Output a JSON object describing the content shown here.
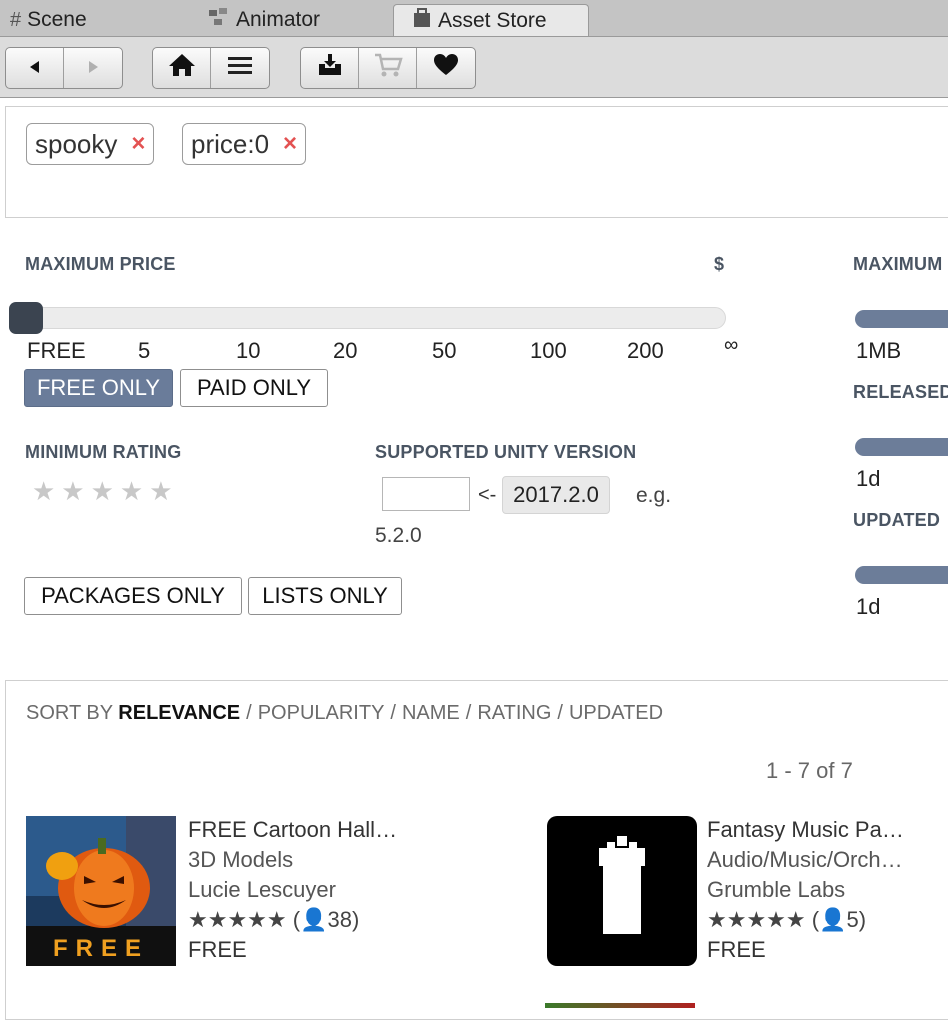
{
  "tabs": [
    {
      "label": "Scene",
      "icon": "grid-icon"
    },
    {
      "label": "Animator",
      "icon": "animator-icon"
    },
    {
      "label": "Asset Store",
      "icon": "store-bag-icon",
      "active": true
    }
  ],
  "toolbar": {
    "buttons": [
      "back-arrow-icon",
      "forward-arrow-icon",
      "home-icon",
      "menu-icon",
      "download-tray-icon",
      "cart-icon",
      "heart-icon"
    ]
  },
  "search": {
    "chips": [
      {
        "label": "spooky",
        "remove": "×"
      },
      {
        "label": "price:0",
        "remove": "×"
      }
    ]
  },
  "filters": {
    "max_price_label": "MAXIMUM PRICE",
    "currency": "$",
    "price_ticks": [
      "FREE",
      "5",
      "10",
      "20",
      "50",
      "100",
      "200",
      "∞"
    ],
    "price_value": "FREE",
    "free_only": "FREE ONLY",
    "paid_only": "PAID ONLY",
    "min_rating_label": "MINIMUM RATING",
    "rating_stars": "★★★★★",
    "rating_value": 0,
    "unity_version_label": "SUPPORTED UNITY VERSION",
    "version_input_value": "",
    "arrow": "<-",
    "current_version": "2017.2.0",
    "example_prefix": "e.g.",
    "example_version": "5.2.0",
    "packages_only": "PACKAGES ONLY",
    "lists_only": "LISTS ONLY",
    "max_size_label": "MAXIMUM",
    "max_size_value": "1MB",
    "released_label": "RELEASED",
    "released_value": "1d",
    "updated_label": "UPDATED",
    "updated_value": "1d"
  },
  "sort": {
    "prefix": "SORT BY",
    "active": "RELEVANCE",
    "options": [
      "POPULARITY",
      "NAME",
      "RATING",
      "UPDATED"
    ],
    "separator": "/"
  },
  "results": {
    "count_text": "1 - 7 of 7",
    "items": [
      {
        "title": "FREE Cartoon Hall…",
        "category": "3D Models",
        "publisher": "Lucie Lescuyer",
        "stars": "★★★★★",
        "reviews": "(👤38)",
        "price": "FREE",
        "badge": "FREE"
      },
      {
        "title": "Fantasy Music Pa…",
        "category": "Audio/Music/Orch…",
        "publisher": "Grumble Labs",
        "stars": "★★★★★",
        "reviews": "(👤5)",
        "price": "FREE"
      }
    ]
  },
  "colors": {
    "accent": "#6a7c9a",
    "slider_thumb": "#3b4450",
    "remove_x": "#e35252",
    "label": "#4a5563"
  }
}
